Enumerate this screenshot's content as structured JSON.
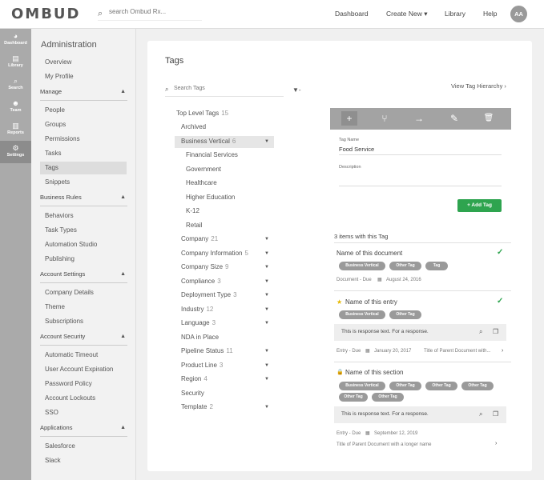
{
  "app": {
    "logo": "OMBUD"
  },
  "topbar": {
    "search_placeholder": "search Ombud Rx...",
    "nav": {
      "dashboard": "Dashboard",
      "create_new": "Create New",
      "create_new_caret": "▾",
      "library": "Library",
      "help": "Help"
    },
    "avatar": "AA"
  },
  "rail": [
    {
      "label": "Dashboard",
      "icon": "dashboard-icon",
      "glyph": "◕"
    },
    {
      "label": "Library",
      "icon": "library-icon",
      "glyph": "▤"
    },
    {
      "label": "Search",
      "icon": "search-icon",
      "glyph": "⌕"
    },
    {
      "label": "Team",
      "icon": "team-icon",
      "glyph": "☻"
    },
    {
      "label": "Reports",
      "icon": "reports-icon",
      "glyph": "▥"
    },
    {
      "label": "Settings",
      "icon": "settings-icon",
      "glyph": "⚙"
    }
  ],
  "sidebar": {
    "title": "Administration",
    "top_links": [
      "Overview",
      "My Profile"
    ],
    "sections": [
      {
        "label": "Manage",
        "items": [
          "People",
          "Groups",
          "Permissions",
          "Tasks",
          "Tags",
          "Snippets"
        ]
      },
      {
        "label": "Business Rules",
        "items": [
          "Behaviors",
          "Task Types",
          "Automation Studio",
          "Publishing"
        ]
      },
      {
        "label": "Account Settings",
        "items": [
          "Company Details",
          "Theme",
          "Subscriptions"
        ]
      },
      {
        "label": "Account Security",
        "items": [
          "Automatic Timeout",
          "User Account Expiration",
          "Password Policy",
          "Account Lockouts",
          "SSO"
        ]
      },
      {
        "label": "Applications",
        "items": [
          "Salesforce",
          "Slack"
        ]
      }
    ],
    "section_caret": "▲",
    "active_item": "Tags"
  },
  "tags_page": {
    "title": "Tags",
    "search_placeholder": "Search Tags",
    "search_icon": "⌕",
    "filter_label": "▼-",
    "view_hierarchy": "View Tag Hierarchy ›",
    "top_level_label": "Top Level Tags",
    "top_level_count": "15",
    "tree": [
      {
        "label": "Archived",
        "count": "",
        "caret": false,
        "indent": 0
      },
      {
        "label": "Business Vertical",
        "count": "6",
        "caret": true,
        "indent": 0,
        "selected": true
      },
      {
        "label": "Financial Services",
        "count": "",
        "caret": false,
        "indent": 1
      },
      {
        "label": "Government",
        "count": "",
        "caret": false,
        "indent": 1
      },
      {
        "label": "Healthcare",
        "count": "",
        "caret": false,
        "indent": 1
      },
      {
        "label": "Higher Education",
        "count": "",
        "caret": false,
        "indent": 1
      },
      {
        "label": "K-12",
        "count": "",
        "caret": false,
        "indent": 1
      },
      {
        "label": "Retail",
        "count": "",
        "caret": false,
        "indent": 1
      },
      {
        "label": "Company",
        "count": "21",
        "caret": true,
        "indent": 0
      },
      {
        "label": "Company Information",
        "count": "5",
        "caret": true,
        "indent": 0
      },
      {
        "label": "Company Size",
        "count": "9",
        "caret": true,
        "indent": 0
      },
      {
        "label": "Compliance",
        "count": "3",
        "caret": true,
        "indent": 0
      },
      {
        "label": "Deployment Type",
        "count": "3",
        "caret": true,
        "indent": 0
      },
      {
        "label": "Industry",
        "count": "12",
        "caret": true,
        "indent": 0
      },
      {
        "label": "Language",
        "count": "3",
        "caret": true,
        "indent": 0
      },
      {
        "label": "NDA in Place",
        "count": "",
        "caret": false,
        "indent": 0
      },
      {
        "label": "Pipeline Status",
        "count": "11",
        "caret": true,
        "indent": 0
      },
      {
        "label": "Product Line",
        "count": "3",
        "caret": true,
        "indent": 0
      },
      {
        "label": "Region",
        "count": "4",
        "caret": true,
        "indent": 0
      },
      {
        "label": "Security",
        "count": "",
        "caret": false,
        "indent": 0
      },
      {
        "label": "Template",
        "count": "2",
        "caret": true,
        "indent": 0
      }
    ],
    "tree_caret": "▼",
    "toolbar": [
      {
        "name": "add-tag-icon",
        "glyph": "+"
      },
      {
        "name": "branch-icon",
        "glyph": "⑂"
      },
      {
        "name": "move-arrow-icon",
        "glyph": "→"
      },
      {
        "name": "edit-pencil-icon",
        "glyph": "✎"
      },
      {
        "name": "trash-icon",
        "glyph": "🗑"
      }
    ],
    "form": {
      "tag_name_label": "Tag Name",
      "tag_name_value": "Food Service",
      "description_label": "Description",
      "add_button": "+ Add Tag"
    },
    "items_count": "3 items with this Tag",
    "items": [
      {
        "title": "Name of this document",
        "pills": [
          "Business Vertical",
          "Other Tag",
          "Tag"
        ],
        "meta": "Document - Due",
        "date": "August 24, 2016"
      },
      {
        "title": "Name of this entry",
        "pills": [
          "Business Vertical",
          "Other Tag"
        ],
        "response": "This is response text. For a response.",
        "meta": "Entry - Due",
        "date": "January 20, 2017",
        "parent": "Title of Parent Document with..."
      },
      {
        "title": "Name of this section",
        "pills": [
          "Business Vertical",
          "Other Tag",
          "Other Tag",
          "Other Tag",
          "Other Tag",
          "Other Tag"
        ],
        "response": "This is response text. For a response.",
        "meta": "Entry - Due",
        "date": "September 12, 2019",
        "parent": "Title of Parent Document with a longer name"
      }
    ],
    "glyphs": {
      "check": "✓",
      "star": "★",
      "lock": "🔒",
      "calendar": "▦",
      "zoom": "⌕",
      "copy": "❐",
      "chevron": "›"
    }
  },
  "colors": {
    "accent_green": "#2ea44f",
    "toolbar_gray": "#a3a3a3",
    "pill_gray": "#9a9a9a",
    "rail_gray": "#aaaaaa"
  }
}
